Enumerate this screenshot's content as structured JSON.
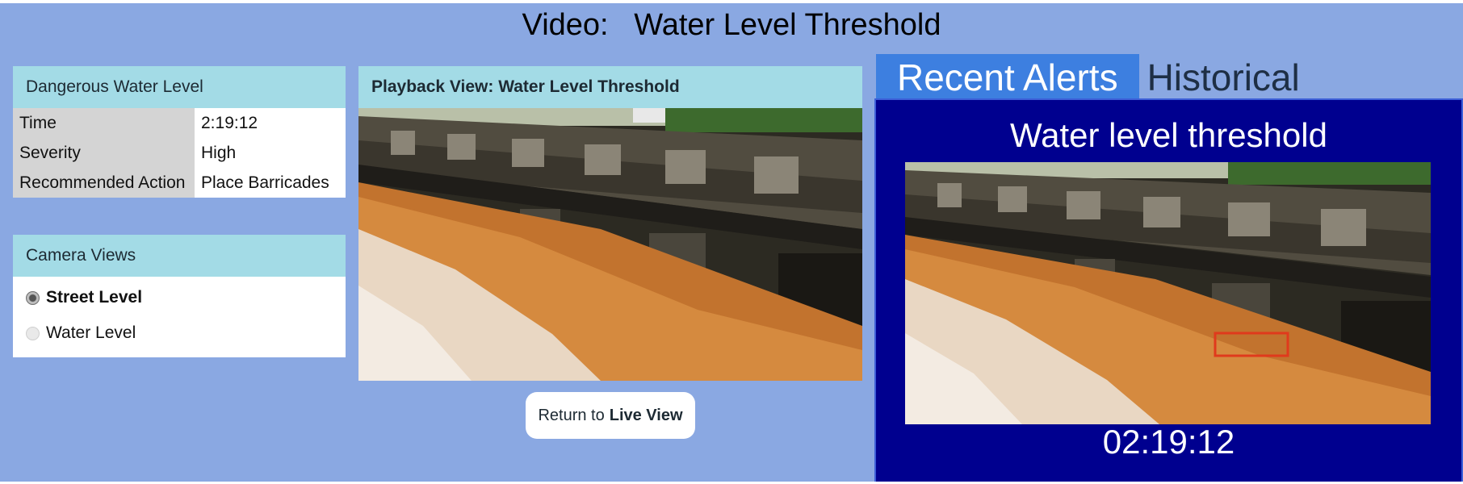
{
  "header": {
    "title": "Video:   Water Level Threshold"
  },
  "alert_details": {
    "heading": "Dangerous Water Level",
    "rows": [
      {
        "key": "Time",
        "value": "2:19:12"
      },
      {
        "key": "Severity",
        "value": "High"
      },
      {
        "key": "Recommended Action",
        "value": "Place Barricades"
      }
    ]
  },
  "camera_views": {
    "heading": "Camera Views",
    "options": [
      {
        "label": "Street Level",
        "selected": true
      },
      {
        "label": "Water Level",
        "selected": false
      }
    ]
  },
  "playback": {
    "heading": "Playback View: Water Level Threshold",
    "return_prefix": "Return to",
    "return_bold": "Live View"
  },
  "alerts": {
    "tabs": [
      {
        "label": "Recent Alerts",
        "active": true
      },
      {
        "label": "Historical",
        "active": false
      }
    ],
    "alert_title": "Water level threshold",
    "alert_time": "02:19:12"
  },
  "colors": {
    "background": "#8aa8e2",
    "panel_header": "#a3dbe6",
    "active_tab": "#3d7fe0",
    "alert_panel": "#00008f",
    "detection_box": "#e03a1c"
  }
}
